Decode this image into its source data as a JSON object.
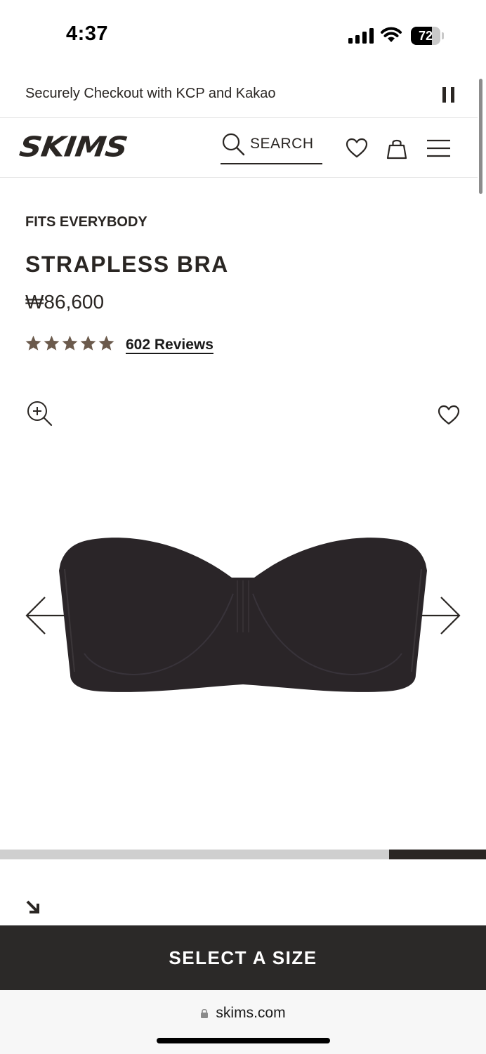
{
  "status_bar": {
    "time": "4:37",
    "battery": "72",
    "battery_level": 0.72,
    "icons": [
      "cellular-signal-icon",
      "wifi-icon",
      "battery-icon"
    ]
  },
  "promo": {
    "text": "Securely Checkout with KCP and Kakao",
    "pause_icon": "pause-icon"
  },
  "header": {
    "logo": "SKIMS",
    "search_label": "SEARCH",
    "icons": [
      "search-icon",
      "heart-icon",
      "shopping-bag-icon",
      "hamburger-menu-icon"
    ]
  },
  "product": {
    "collection": "FITS EVERYBODY",
    "title": "STRAPLESS BRA",
    "price": "₩86,600",
    "rating": 5,
    "reviews_label": "602 Reviews"
  },
  "gallery": {
    "icons": [
      "zoom-in-icon",
      "heart-icon",
      "arrow-left-icon",
      "arrow-right-icon",
      "arrow-down-right-icon"
    ],
    "scroll_progress": {
      "start": 0.8,
      "end": 1.0
    },
    "product_color": "#2a2528"
  },
  "cta": {
    "label": "SELECT A SIZE"
  },
  "browser": {
    "url": "skims.com",
    "lock_icon": "lock-icon"
  },
  "colors": {
    "text_primary": "#2a2623",
    "cta_background": "#2b2928",
    "star": "#6b5a4c",
    "progress_track": "#cfcfcf"
  }
}
